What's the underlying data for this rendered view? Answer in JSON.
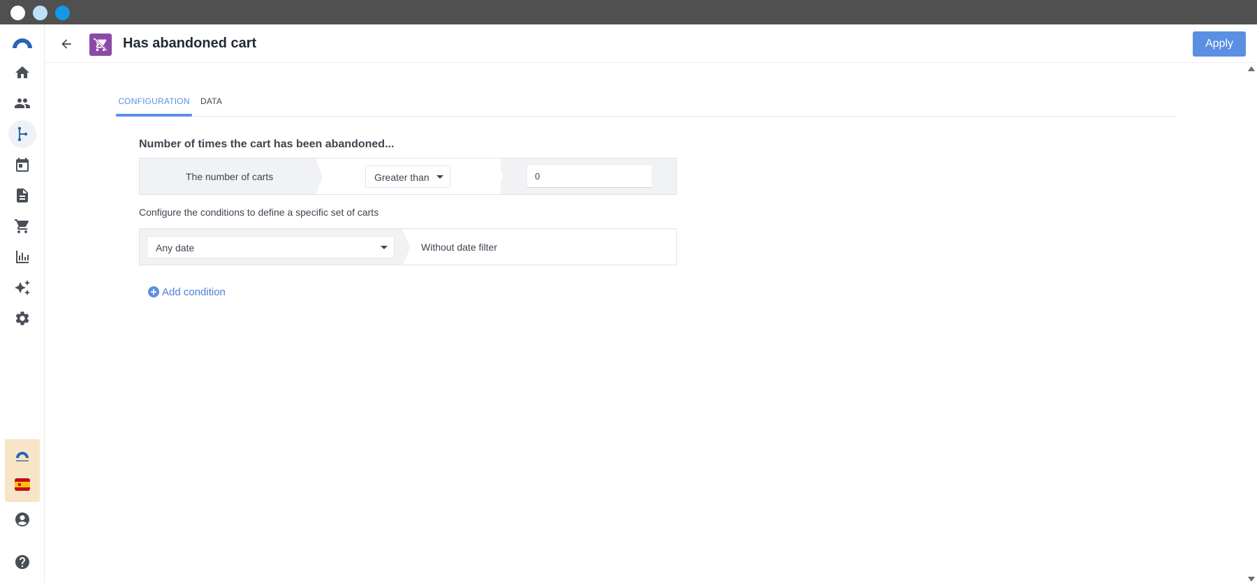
{
  "window": {
    "controls": [
      "close",
      "minimize",
      "maximize"
    ]
  },
  "sidebar": {
    "items": [
      {
        "icon": "home-icon",
        "active": false
      },
      {
        "icon": "people-icon",
        "active": false
      },
      {
        "icon": "flow-icon",
        "active": true
      },
      {
        "icon": "calendar-icon",
        "active": false
      },
      {
        "icon": "document-icon",
        "active": false
      },
      {
        "icon": "cart-icon",
        "active": false
      },
      {
        "icon": "bar-chart-icon",
        "active": false
      },
      {
        "icon": "sparkles-icon",
        "active": false
      },
      {
        "icon": "gear-icon",
        "active": false
      }
    ],
    "bottom": [
      "brand-logo",
      "spain-flag-icon",
      "account-icon",
      "help-icon"
    ]
  },
  "header": {
    "title": "Has abandoned cart",
    "apply_label": "Apply"
  },
  "tabs": [
    {
      "label": "CONFIGURATION",
      "active": true
    },
    {
      "label": "DATA",
      "active": false
    }
  ],
  "section": {
    "title": "Number of times the cart has been abandoned...",
    "count_label": "The number of carts",
    "operator": "Greater than",
    "value": "0",
    "config_text": "Configure the conditions to define a specific set of carts",
    "date_select": "Any date",
    "date_filter_text": "Without date filter",
    "add_condition_label": "Add condition"
  },
  "colors": {
    "accent": "#5b8fe4",
    "badge": "#8a4aa8",
    "titlebar": "#505050"
  }
}
